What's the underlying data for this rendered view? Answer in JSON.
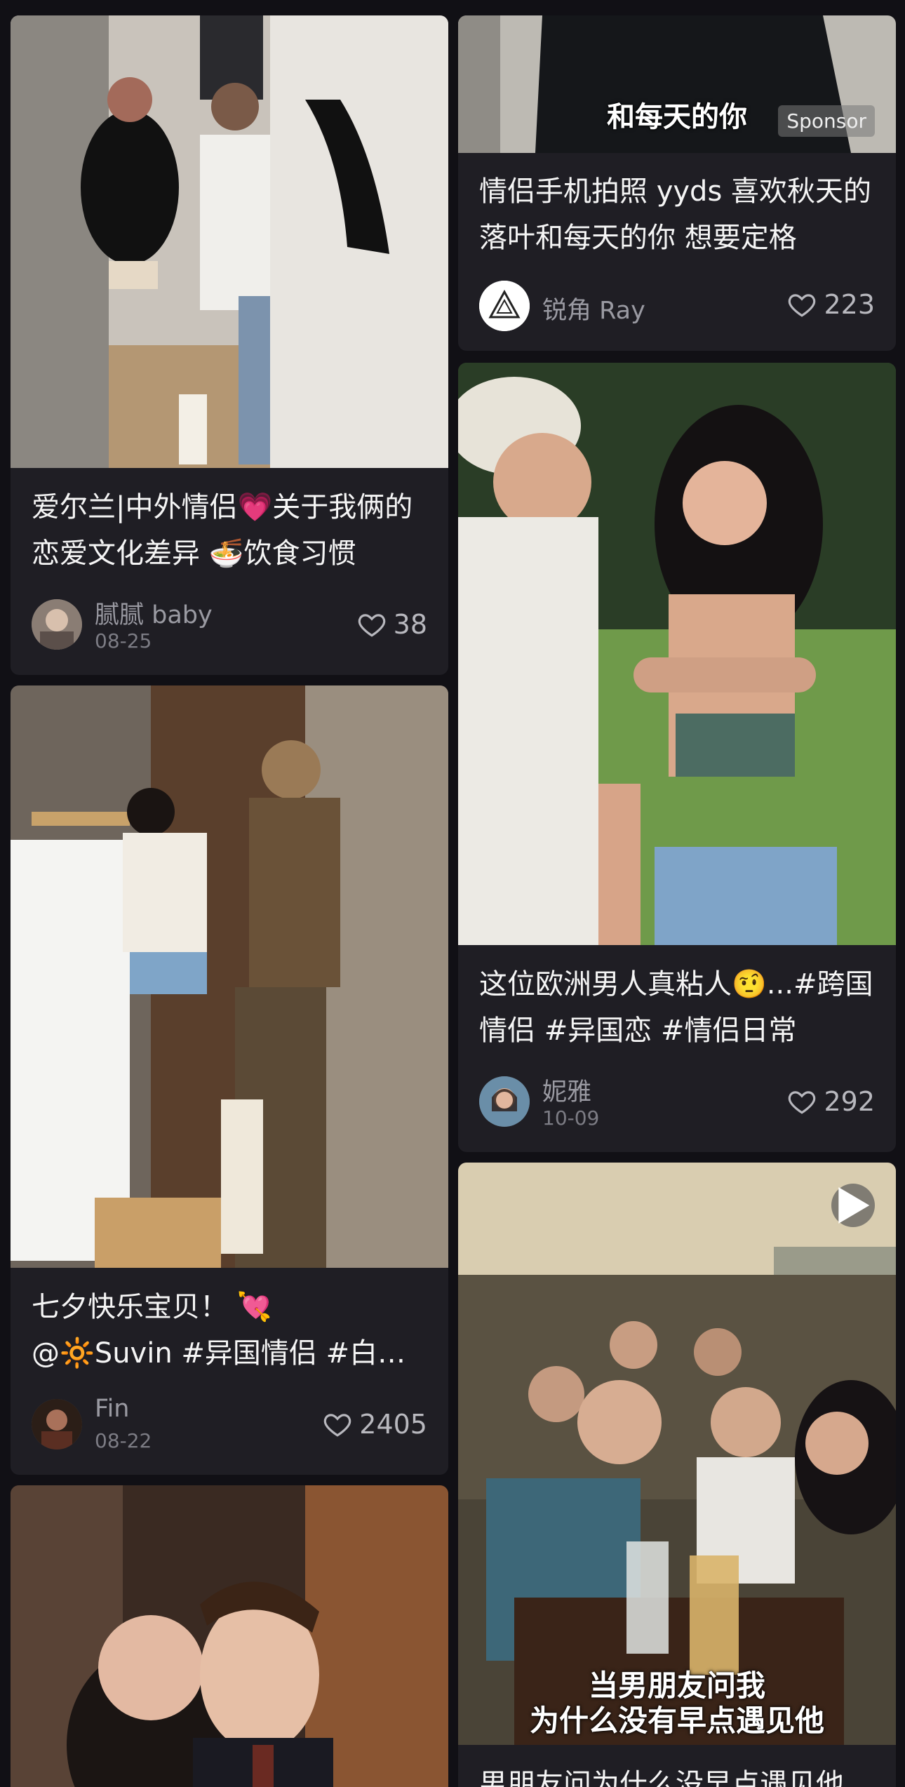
{
  "feed": {
    "left": [
      {
        "title": "爱尔兰|中外情侣💗关于我俩的恋爱文化差异 🍜饮食习惯",
        "author": "腻腻 baby",
        "date": "08-25",
        "likes": "38"
      },
      {
        "title": "七夕快乐宝贝！ 💘\n@🔆Suvin #异国情侣 #白人男友",
        "author": "Fin",
        "date": "08-22",
        "likes": "2405"
      },
      {
        "title": "",
        "author": "",
        "date": "",
        "likes": ""
      }
    ],
    "right": [
      {
        "overlay": "和每天的你",
        "badge": "Sponsor",
        "title": "情侣手机拍照 yyds 喜欢秋天的落叶和每天的你 想要定格",
        "author": "锐角 Ray",
        "likes": "223"
      },
      {
        "title": "这位欧洲男人真粘人🤨...#跨国情侣 #异国恋 #情侣日常",
        "author": "妮雅",
        "date": "10-09",
        "likes": "292"
      },
      {
        "overlay_line1": "当男朋友问我",
        "overlay_line2": "为什么没有早点遇见他",
        "title": "男朋友问为什么没早点遇见他",
        "icons": {
          "play": "play-icon"
        }
      }
    ]
  },
  "icons": {
    "like": "heart-outline-icon"
  },
  "colors": {
    "background": "#111015",
    "card": "#1f1e24",
    "muted": "#9a9aa2"
  }
}
